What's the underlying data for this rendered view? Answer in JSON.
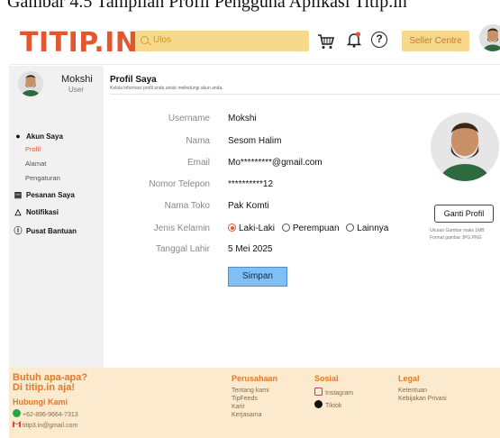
{
  "caption": "Gambar 4.5 Tampilan Profil Pengguna Aplikasi Titip.in",
  "header": {
    "logo": "TITIP.IN",
    "search_placeholder": "Ulos",
    "seller_label": "Seller Centre",
    "help_glyph": "?"
  },
  "sidebar": {
    "user_name": "Mokshi",
    "user_role": "User",
    "items": [
      {
        "label": "Akun Saya",
        "icon": "user-icon"
      },
      {
        "label": "Pesanan Saya",
        "icon": "receipt-icon"
      },
      {
        "label": "Notifikasi",
        "icon": "bell-icon"
      },
      {
        "label": "Pusat Bantuan",
        "icon": "help-icon"
      }
    ],
    "sub_items": [
      "Profil",
      "Alamat",
      "Pengaturan"
    ],
    "active_sub": "Profil"
  },
  "profile": {
    "title": "Profil Saya",
    "subtitle": "Kelola informasi profil anda untuk melindungi akun anda.",
    "fields": [
      {
        "label": "Username",
        "value": "Mokshi"
      },
      {
        "label": "Nama",
        "value": "Sesom Halim"
      },
      {
        "label": "Email",
        "value": "Mo*********@gmail.com"
      },
      {
        "label": "Nomor Telepon",
        "value": "**********12"
      },
      {
        "label": "Nama Toko",
        "value": "Pak Komti"
      }
    ],
    "gender_label": "Jenis Kelamin",
    "gender_options": [
      "Laki-Laki",
      "Perempuan",
      "Lainnya"
    ],
    "gender_selected": "Laki-Laki",
    "birth_label": "Tanggal Lahir",
    "birth_value": "5 Mei 2025",
    "save_label": "Simpan",
    "change_photo_label": "Ganti Profil",
    "photo_hint_1": "Ukuran Gambar maks 1MB",
    "photo_hint_2": "Format gambar JPG,PNG"
  },
  "footer": {
    "title_1": "Butuh apa-apa?",
    "title_2": "Di titip.in aja!",
    "contact_title": "Hubungi Kami",
    "phone": "+62-896-9664-7313",
    "email": "titip3.in@gmail.com",
    "company_title": "Perusahaan",
    "company_links": [
      "Tentang kami",
      "TipFeeds",
      "Karir",
      "Kerjasama"
    ],
    "social_title": "Sosial",
    "social_links": [
      "Instagram",
      "Tiktok"
    ],
    "legal_title": "Legal",
    "legal_links": [
      "Ketentuan",
      "Kebijakan Privasi"
    ]
  },
  "colors": {
    "brand": "#e4572e",
    "search_bg": "#f6d98c",
    "footer_bg": "#fbeacd",
    "sidebar_bg": "#f1f1f1",
    "save_bg": "#7fbff3"
  }
}
